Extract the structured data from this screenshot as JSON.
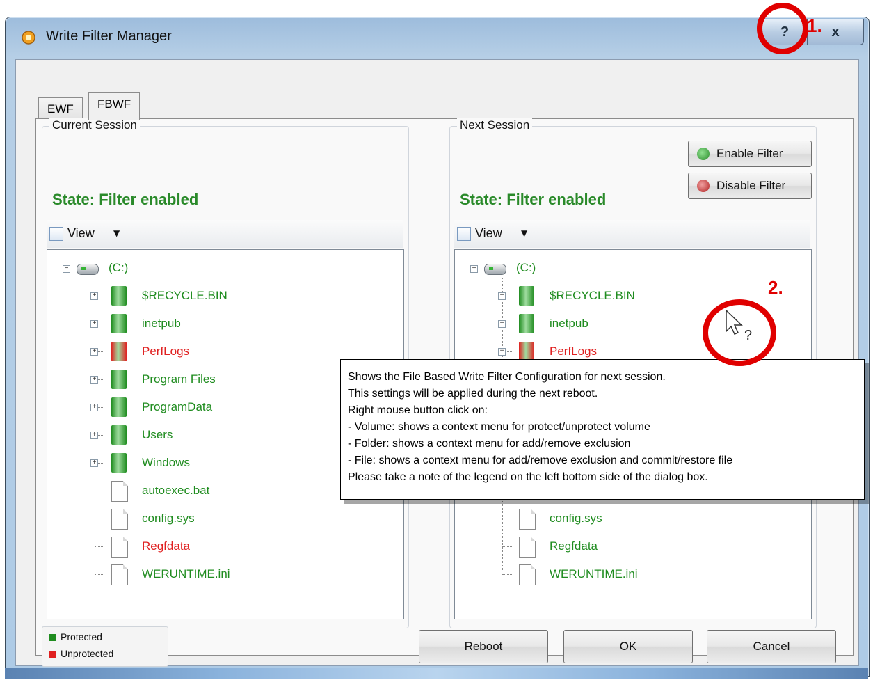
{
  "window": {
    "title": "Write Filter Manager",
    "help_label": "?",
    "close_label": "x"
  },
  "tabs": [
    {
      "label": "EWF"
    },
    {
      "label": "FBWF"
    }
  ],
  "current_session": {
    "group_label": "Current Session",
    "state": "State: Filter enabled",
    "view_label": "View",
    "root": "(C:)",
    "items": [
      {
        "name": "$RECYCLE.BIN",
        "status": "protected",
        "type": "folder"
      },
      {
        "name": "inetpub",
        "status": "protected",
        "type": "folder"
      },
      {
        "name": "PerfLogs",
        "status": "unprotected",
        "type": "folder"
      },
      {
        "name": "Program Files",
        "status": "protected",
        "type": "folder"
      },
      {
        "name": "ProgramData",
        "status": "protected",
        "type": "folder"
      },
      {
        "name": "Users",
        "status": "protected",
        "type": "folder"
      },
      {
        "name": "Windows",
        "status": "protected",
        "type": "folder"
      },
      {
        "name": "autoexec.bat",
        "status": "protected",
        "type": "file"
      },
      {
        "name": "config.sys",
        "status": "protected",
        "type": "file"
      },
      {
        "name": "Regfdata",
        "status": "unprotected",
        "type": "file"
      },
      {
        "name": "WERUNTIME.ini",
        "status": "protected",
        "type": "file"
      }
    ]
  },
  "next_session": {
    "group_label": "Next Session",
    "enable_label": "Enable Filter",
    "disable_label": "Disable Filter",
    "state": "State: Filter enabled",
    "view_label": "View",
    "root": "(C:)",
    "items": [
      {
        "name": "$RECYCLE.BIN",
        "status": "protected",
        "type": "folder"
      },
      {
        "name": "inetpub",
        "status": "protected",
        "type": "folder"
      },
      {
        "name": "PerfLogs",
        "status": "unprotected",
        "type": "folder"
      },
      {
        "name": "config.sys",
        "status": "protected",
        "type": "file"
      },
      {
        "name": "Regfdata",
        "status": "protected",
        "type": "file"
      },
      {
        "name": "WERUNTIME.ini",
        "status": "protected",
        "type": "file"
      }
    ]
  },
  "tooltip": {
    "lines": [
      "Shows the File Based Write Filter Configuration for next session.",
      "This settings will be applied during the next reboot.",
      "Right mouse button click on:",
      "- Volume: shows a context menu for protect/unprotect volume",
      "- Folder: shows a context menu for add/remove exclusion",
      "- File: shows a context menu for add/remove exclusion and commit/restore file",
      "Please take a note of the legend on the left bottom side of the dialog box."
    ]
  },
  "legend": {
    "protected": "Protected",
    "unprotected": "Unprotected"
  },
  "buttons": {
    "reboot": "Reboot",
    "ok": "OK",
    "cancel": "Cancel"
  },
  "annotations": {
    "marker1": "1.",
    "marker2": "2."
  },
  "colors": {
    "protected": "#1f8c1f",
    "unprotected": "#e02020",
    "state": "#2a8a2a",
    "annotation": "#e00000"
  }
}
